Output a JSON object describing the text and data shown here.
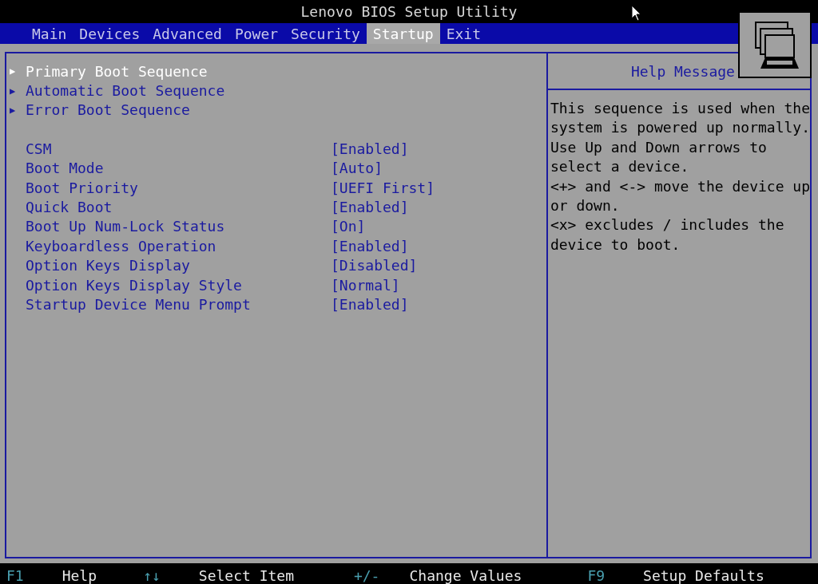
{
  "window": {
    "title": "Lenovo BIOS Setup Utility"
  },
  "tabs": [
    {
      "label": "Main",
      "selected": false
    },
    {
      "label": "Devices",
      "selected": false
    },
    {
      "label": "Advanced",
      "selected": false
    },
    {
      "label": "Power",
      "selected": false
    },
    {
      "label": "Security",
      "selected": false
    },
    {
      "label": "Startup",
      "selected": true
    },
    {
      "label": "Exit",
      "selected": false
    }
  ],
  "submenus": [
    {
      "marker": "▶",
      "label": "Primary Boot Sequence",
      "selected": true
    },
    {
      "marker": "▶",
      "label": "Automatic Boot Sequence",
      "selected": false
    },
    {
      "marker": "▶",
      "label": "Error Boot Sequence",
      "selected": false
    }
  ],
  "settings": [
    {
      "label": "CSM",
      "value": "[Enabled]"
    },
    {
      "label": "Boot Mode",
      "value": "[Auto]"
    },
    {
      "label": "Boot Priority",
      "value": "[UEFI First]"
    },
    {
      "label": "Quick Boot",
      "value": "[Enabled]"
    },
    {
      "label": "Boot Up Num-Lock Status",
      "value": "[On]"
    },
    {
      "label": "Keyboardless Operation",
      "value": "[Enabled]"
    },
    {
      "label": "Option Keys Display",
      "value": "[Disabled]"
    },
    {
      "label": "Option Keys Display Style",
      "value": "[Normal]"
    },
    {
      "label": "Startup Device Menu Prompt",
      "value": "[Enabled]"
    }
  ],
  "help": {
    "title": "Help Message",
    "lines": [
      "This sequence is used when the",
      "system is powered up normally.",
      "Use Up and Down arrows to",
      "select a device.",
      "<+> and <-> move the device up",
      "or down.",
      "<x> excludes / includes the",
      "device to boot."
    ]
  },
  "status_bar": [
    {
      "key": "F1",
      "action": "Help"
    },
    {
      "key": "↑↓",
      "action": "Select Item"
    },
    {
      "key": "+/-",
      "action": "Change Values"
    },
    {
      "key": "F9",
      "action": "Setup Defaults"
    }
  ]
}
